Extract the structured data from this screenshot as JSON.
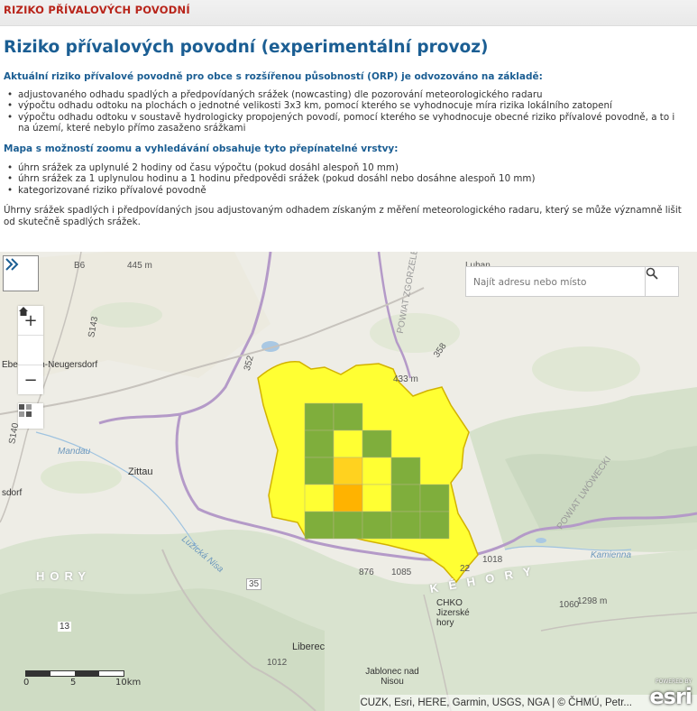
{
  "topbar": {
    "title": "RIZIKO PŘÍVALOVÝCH POVODNÍ"
  },
  "page": {
    "heading": "Riziko přívalových povodní (experimentální provoz)",
    "section1": {
      "title": "Aktuální riziko přívalové povodně pro obce s rozšířenou působností (ORP) je odvozováno na základě:",
      "items": [
        "adjustovaného odhadu spadlých a předpovídaných srážek (nowcasting) dle pozorování meteorologického radaru",
        "výpočtu odhadu odtoku na plochách o jednotné velikosti 3x3 km, pomocí kterého se vyhodnocuje míra rizika lokálního zatopení",
        "výpočtu odhadu odtoku v soustavě hydrologicky propojených povodí, pomocí kterého se vyhodnocuje obecné riziko přívalové povodně, a to i na území, které nebylo přímo zasaženo srážkami"
      ]
    },
    "section2": {
      "title": "Mapa s možností zoomu a vyhledávání obsahuje tyto přepínatelné vrstvy:",
      "items": [
        "úhrn srážek za uplynulé 2 hodiny od času výpočtu (pokud dosáhl alespoň 10 mm)",
        "úhrn srážek za 1 uplynulou hodinu a 1 hodinu předpovědi srážek (pokud dosáhl nebo dosáhne alespoň 10 mm)",
        "kategorizované riziko přívalové povodně"
      ]
    },
    "note": "Úhrny srážek spadlých i předpovídaných jsou adjustovaným odhadem získaným z měření meteorologického radaru, který se může významně lišit od skutečně spadlých srážek."
  },
  "map": {
    "search_placeholder": "Najít adresu nebo místo",
    "zoom_in": "+",
    "zoom_out": "−",
    "attribution": "CUZK, Esri, HERE, Garmin, USGS, NGA | © ČHMÚ, Petr...",
    "esri_powered": "POWERED BY",
    "esri_logo": "esri",
    "scale": {
      "label_start": "0",
      "label_mid": "5",
      "label_end": "10km"
    },
    "labels": {
      "zittau": "Zittau",
      "liberec": "Liberec",
      "jablonec": "Jablonec nad Nisou",
      "chko": "CHKO Jizerské hory",
      "ebersbach": "Ebersbach-Neugersdorf",
      "dorf": "sdorf",
      "hory1": "HORY",
      "hory2": "K É   H O R Y",
      "kamienna": "Kamienna",
      "powiat": "POWIAT LWÓWECKI",
      "powiat2": "POWIAT ZGORZELECKI",
      "mandau": "Mandau",
      "nisa": "Lužická Nisa",
      "e445": "445 m",
      "e433": "433 m",
      "e1298": "1298 m",
      "r352": "352",
      "r358": "358",
      "r13": "13",
      "r35": "35",
      "r1018": "1018",
      "r1060": "1060",
      "r1085": "1085",
      "r876": "876",
      "r1012": "1012",
      "r22": "22",
      "rs140": "S140",
      "rs143": "S143",
      "rb6": "B6",
      "luban": "Luban"
    }
  },
  "colors": {
    "heading": "#1b5e93",
    "topbar_text": "#b8241a",
    "risk_low": "#ffff33",
    "risk_green": "#7fae3c",
    "risk_mid": "#ffd21f",
    "risk_high": "#ffb300"
  },
  "icons": {
    "expand": "double-chevron-right-icon",
    "home": "home-icon",
    "layers": "layers-icon",
    "search": "search-icon"
  }
}
